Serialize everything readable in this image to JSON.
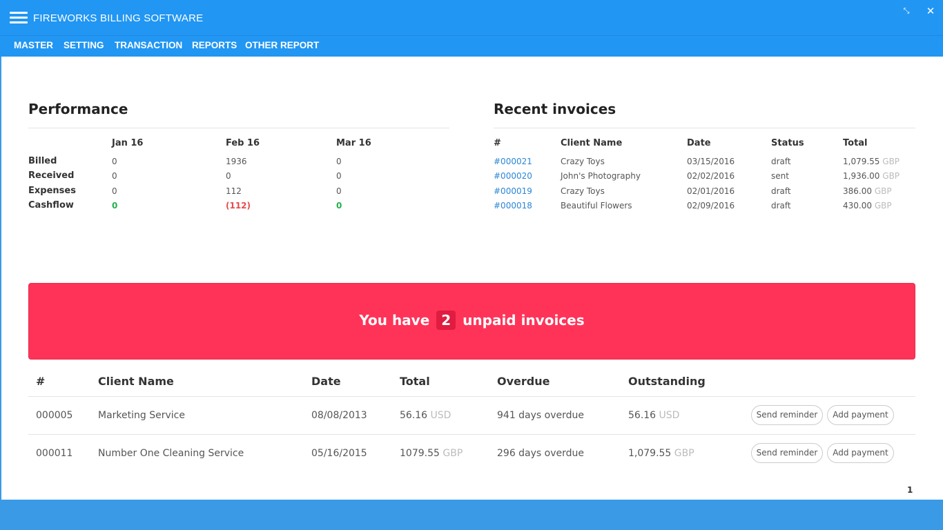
{
  "window": {
    "title": "FIREWORKS BILLING SOFTWARE",
    "minimize_glyph": "⤡",
    "close_glyph": "✕"
  },
  "menu": [
    "MASTER",
    "SETTING",
    "TRANSACTION",
    "REPORTS",
    "OTHER REPORT"
  ],
  "performance": {
    "title": "Performance",
    "months": [
      "Jan 16",
      "Feb 16",
      "Mar 16"
    ],
    "rows": [
      {
        "label": "Billed",
        "values": [
          "0",
          "1936",
          "0"
        ]
      },
      {
        "label": "Received",
        "values": [
          "0",
          "0",
          "0"
        ]
      },
      {
        "label": "Expenses",
        "values": [
          "0",
          "112",
          "0"
        ]
      },
      {
        "label": "Cashflow",
        "values": [
          "0",
          "(112)",
          "0"
        ],
        "status": [
          "positive",
          "negative",
          "positive"
        ]
      }
    ]
  },
  "recent_invoices": {
    "title": "Recent invoices",
    "headers": [
      "#",
      "Client Name",
      "Date",
      "Status",
      "Total"
    ],
    "rows": [
      {
        "id": "#000021",
        "client": "Crazy Toys",
        "date": "03/15/2016",
        "status": "draft",
        "amount": "1,079.55",
        "currency": "GBP"
      },
      {
        "id": "#000020",
        "client": "John's Photography",
        "date": "02/02/2016",
        "status": "sent",
        "amount": "1,936.00",
        "currency": "GBP"
      },
      {
        "id": "#000019",
        "client": "Crazy Toys",
        "date": "02/01/2016",
        "status": "draft",
        "amount": "386.00",
        "currency": "GBP"
      },
      {
        "id": "#000018",
        "client": "Beautiful Flowers",
        "date": "02/09/2016",
        "status": "draft",
        "amount": "430.00",
        "currency": "GBP"
      }
    ]
  },
  "alert": {
    "prefix": "You have",
    "count": "2",
    "suffix": "unpaid invoices",
    "color": "#ff3358"
  },
  "unpaid": {
    "headers": [
      "#",
      "Client Name",
      "Date",
      "Total",
      "Overdue",
      "Outstanding"
    ],
    "rows": [
      {
        "id": "000005",
        "client": "Marketing Service",
        "date": "08/08/2013",
        "total": "56.16",
        "total_currency": "USD",
        "overdue": "941 days overdue",
        "outstanding": "56.16",
        "outstanding_currency": "USD"
      },
      {
        "id": "000011",
        "client": "Number One Cleaning Service",
        "date": "05/16/2015",
        "total": "1079.55",
        "total_currency": "GBP",
        "overdue": "296 days overdue",
        "outstanding": "1,079.55",
        "outstanding_currency": "GBP"
      }
    ],
    "actions": {
      "reminder": "Send reminder",
      "payment": "Add payment"
    }
  },
  "pagination": {
    "current": "1"
  },
  "colors": {
    "accent": "#2196f3",
    "positive": "#22b14c",
    "negative": "#e84a4a",
    "link": "#2a86d6"
  }
}
